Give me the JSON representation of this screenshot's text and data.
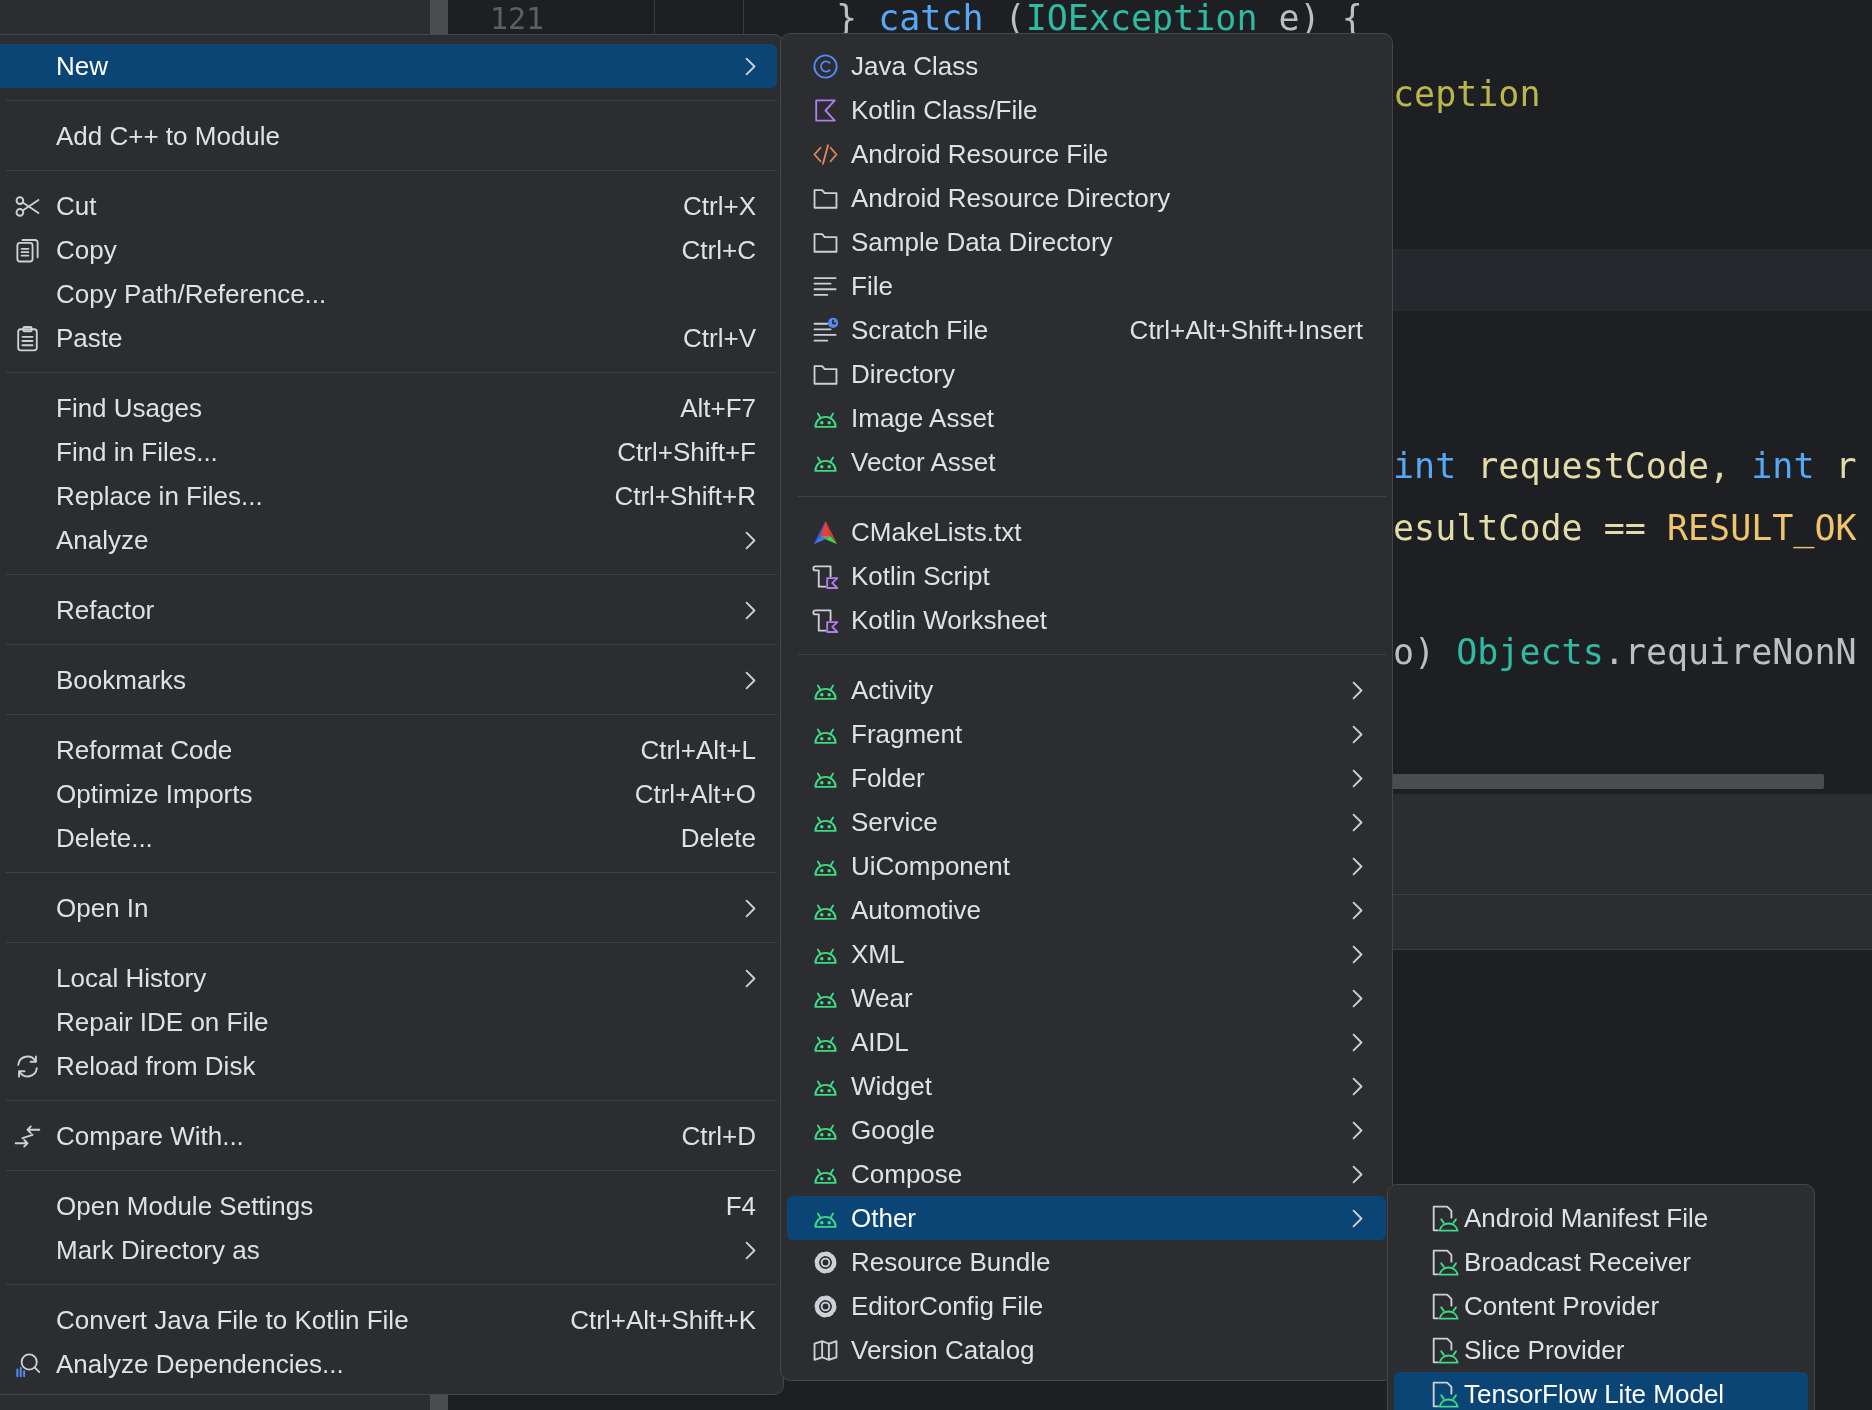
{
  "editor": {
    "lines": [
      {
        "kind": "code",
        "number": "121",
        "tokens": [
          {
            "text": "} ",
            "kind": "plain"
          },
          {
            "text": "catch",
            "kind": "keyword"
          },
          {
            "text": " (",
            "kind": "plain"
          },
          {
            "text": "IOException",
            "kind": "type"
          },
          {
            "text": " e) {",
            "kind": "plain"
          }
        ]
      },
      {
        "kind": "cut",
        "tokens": [
          {
            "text": "ception",
            "kind": "string"
          }
        ]
      },
      {
        "kind": "blank"
      },
      {
        "kind": "blank"
      },
      {
        "kind": "current"
      },
      {
        "kind": "blank"
      },
      {
        "kind": "blank"
      },
      {
        "kind": "cut",
        "tokens": [
          {
            "text": "int",
            "kind": "keyword"
          },
          {
            "text": " requestCode, ",
            "kind": "param"
          },
          {
            "text": "int",
            "kind": "keyword"
          },
          {
            "text": " r",
            "kind": "param"
          }
        ]
      },
      {
        "kind": "cut",
        "tokens": [
          {
            "text": "esultCode == ",
            "kind": "param"
          },
          {
            "text": "RESULT_OK",
            "kind": "constant"
          }
        ]
      },
      {
        "kind": "blank"
      },
      {
        "kind": "cut",
        "tokens": [
          {
            "text": "o) ",
            "kind": "plain"
          },
          {
            "text": "Objects",
            "kind": "type"
          },
          {
            "text": ".requireNonN",
            "kind": "plain"
          }
        ]
      }
    ]
  },
  "menus": [
    {
      "kind": "context",
      "items": [
        {
          "kind": "plain",
          "label": "New",
          "submenu": true,
          "selected": true
        },
        {
          "kind": "separator"
        },
        {
          "kind": "plain",
          "label": "Add C++ to Module",
          "submenu": false,
          "selected": false
        },
        {
          "kind": "separator"
        },
        {
          "kind": "scissors",
          "label": "Cut",
          "shortcut": "Ctrl+X",
          "submenu": false,
          "selected": false
        },
        {
          "kind": "copy",
          "label": "Copy",
          "shortcut": "Ctrl+C",
          "submenu": false,
          "selected": false
        },
        {
          "kind": "plain",
          "label": "Copy Path/Reference...",
          "submenu": false,
          "selected": false
        },
        {
          "kind": "clipboard",
          "label": "Paste",
          "shortcut": "Ctrl+V",
          "submenu": false,
          "selected": false
        },
        {
          "kind": "separator"
        },
        {
          "kind": "plain",
          "label": "Find Usages",
          "shortcut": "Alt+F7",
          "submenu": false,
          "selected": false
        },
        {
          "kind": "plain",
          "label": "Find in Files...",
          "shortcut": "Ctrl+Shift+F",
          "submenu": false,
          "selected": false
        },
        {
          "kind": "plain",
          "label": "Replace in Files...",
          "shortcut": "Ctrl+Shift+R",
          "submenu": false,
          "selected": false
        },
        {
          "kind": "plain",
          "label": "Analyze",
          "submenu": true,
          "selected": false
        },
        {
          "kind": "separator"
        },
        {
          "kind": "plain",
          "label": "Refactor",
          "submenu": true,
          "selected": false
        },
        {
          "kind": "separator"
        },
        {
          "kind": "plain",
          "label": "Bookmarks",
          "submenu": true,
          "selected": false
        },
        {
          "kind": "separator"
        },
        {
          "kind": "plain",
          "label": "Reformat Code",
          "shortcut": "Ctrl+Alt+L",
          "submenu": false,
          "selected": false
        },
        {
          "kind": "plain",
          "label": "Optimize Imports",
          "shortcut": "Ctrl+Alt+O",
          "submenu": false,
          "selected": false
        },
        {
          "kind": "plain",
          "label": "Delete...",
          "shortcut": "Delete",
          "submenu": false,
          "selected": false
        },
        {
          "kind": "separator"
        },
        {
          "kind": "plain",
          "label": "Open In",
          "submenu": true,
          "selected": false
        },
        {
          "kind": "separator"
        },
        {
          "kind": "plain",
          "label": "Local History",
          "submenu": true,
          "selected": false
        },
        {
          "kind": "plain",
          "label": "Repair IDE on File",
          "submenu": false,
          "selected": false
        },
        {
          "kind": "reload",
          "label": "Reload from Disk",
          "submenu": false,
          "selected": false
        },
        {
          "kind": "separator"
        },
        {
          "kind": "compare",
          "label": "Compare With...",
          "shortcut": "Ctrl+D",
          "submenu": false,
          "selected": false
        },
        {
          "kind": "separator"
        },
        {
          "kind": "plain",
          "label": "Open Module Settings",
          "shortcut": "F4",
          "submenu": false,
          "selected": false
        },
        {
          "kind": "plain",
          "label": "Mark Directory as",
          "submenu": true,
          "selected": false
        },
        {
          "kind": "separator"
        },
        {
          "kind": "plain",
          "label": "Convert Java File to Kotlin File",
          "shortcut": "Ctrl+Alt+Shift+K",
          "submenu": false,
          "selected": false
        },
        {
          "kind": "analyze",
          "label": "Analyze Dependencies...",
          "submenu": false,
          "selected": false
        }
      ]
    },
    {
      "kind": "submenu",
      "items": [
        {
          "kind": "class",
          "label": "Java Class",
          "submenu": false,
          "selected": false
        },
        {
          "kind": "kotlin",
          "label": "Kotlin Class/File",
          "submenu": false,
          "selected": false
        },
        {
          "kind": "resource",
          "label": "Android Resource File",
          "submenu": false,
          "selected": false
        },
        {
          "kind": "folder",
          "label": "Android Resource Directory",
          "submenu": false,
          "selected": false
        },
        {
          "kind": "folder",
          "label": "Sample Data Directory",
          "submenu": false,
          "selected": false
        },
        {
          "kind": "file",
          "label": "File",
          "submenu": false,
          "selected": false
        },
        {
          "kind": "scratch",
          "label": "Scratch File",
          "shortcut": "Ctrl+Alt+Shift+Insert",
          "submenu": false,
          "selected": false
        },
        {
          "kind": "folder",
          "label": "Directory",
          "submenu": false,
          "selected": false
        },
        {
          "kind": "android",
          "label": "Image Asset",
          "submenu": false,
          "selected": false
        },
        {
          "kind": "android",
          "label": "Vector Asset",
          "submenu": false,
          "selected": false
        },
        {
          "kind": "separator"
        },
        {
          "kind": "cmake",
          "label": "CMakeLists.txt",
          "submenu": false,
          "selected": false
        },
        {
          "kind": "script",
          "label": "Kotlin Script",
          "submenu": false,
          "selected": false
        },
        {
          "kind": "script",
          "label": "Kotlin Worksheet",
          "submenu": false,
          "selected": false
        },
        {
          "kind": "separator"
        },
        {
          "kind": "android",
          "label": "Activity",
          "submenu": true,
          "selected": false
        },
        {
          "kind": "android",
          "label": "Fragment",
          "submenu": true,
          "selected": false
        },
        {
          "kind": "android",
          "label": "Folder",
          "submenu": true,
          "selected": false
        },
        {
          "kind": "android",
          "label": "Service",
          "submenu": true,
          "selected": false
        },
        {
          "kind": "android",
          "label": "UiComponent",
          "submenu": true,
          "selected": false
        },
        {
          "kind": "android",
          "label": "Automotive",
          "submenu": true,
          "selected": false
        },
        {
          "kind": "android",
          "label": "XML",
          "submenu": true,
          "selected": false
        },
        {
          "kind": "android",
          "label": "Wear",
          "submenu": true,
          "selected": false
        },
        {
          "kind": "android",
          "label": "AIDL",
          "submenu": true,
          "selected": false
        },
        {
          "kind": "android",
          "label": "Widget",
          "submenu": true,
          "selected": false
        },
        {
          "kind": "android",
          "label": "Google",
          "submenu": true,
          "selected": false
        },
        {
          "kind": "android",
          "label": "Compose",
          "submenu": true,
          "selected": false
        },
        {
          "kind": "android",
          "label": "Other",
          "submenu": true,
          "selected": true
        },
        {
          "kind": "settings",
          "label": "Resource Bundle",
          "submenu": false,
          "selected": false
        },
        {
          "kind": "settings",
          "label": "EditorConfig File",
          "submenu": false,
          "selected": false
        },
        {
          "kind": "catalog",
          "label": "Version Catalog",
          "submenu": false,
          "selected": false
        }
      ]
    },
    {
      "kind": "nested",
      "items": [
        {
          "kind": "manifest",
          "label": "Android Manifest File",
          "submenu": false,
          "selected": false
        },
        {
          "kind": "manifest",
          "label": "Broadcast Receiver",
          "submenu": false,
          "selected": false
        },
        {
          "kind": "manifest",
          "label": "Content Provider",
          "submenu": false,
          "selected": false
        },
        {
          "kind": "manifest",
          "label": "Slice Provider",
          "submenu": false,
          "selected": false
        },
        {
          "kind": "manifest",
          "label": "TensorFlow Lite Model",
          "submenu": false,
          "selected": true
        }
      ]
    }
  ]
}
